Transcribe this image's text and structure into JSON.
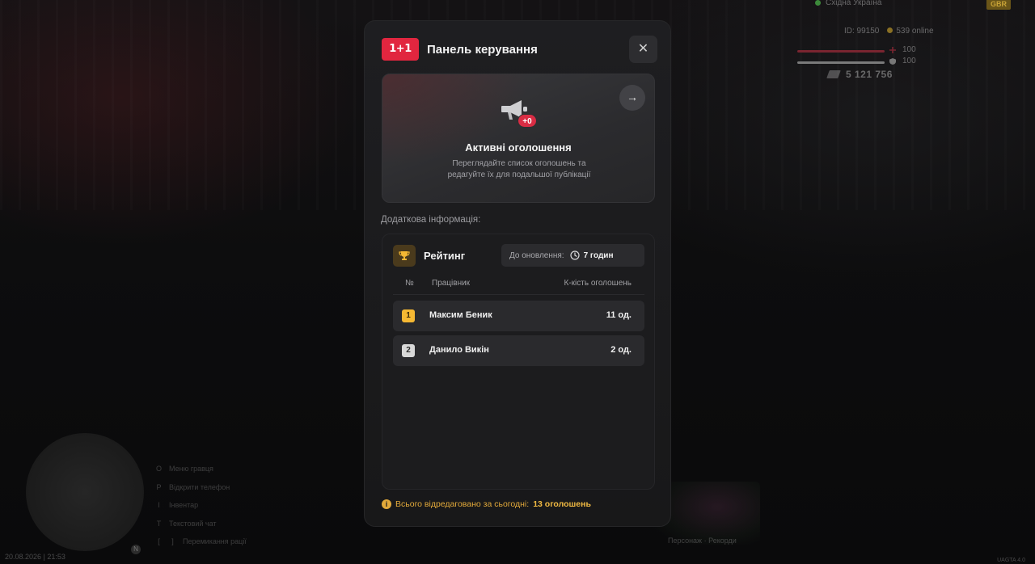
{
  "modal": {
    "title": "Панель керування",
    "logo_text": "1+1",
    "close_label": "✕",
    "ads_card": {
      "badge": "+0",
      "title": "Активні оголошення",
      "description": "Переглядайте список оголошень та редагуйте їх для подальшої публікації",
      "arrow_label": "→"
    },
    "extra_label": "Додаткова інформація:",
    "rating": {
      "title": "Рейтинг",
      "update_label": "До оновлення:",
      "update_value": "7 годин",
      "columns": {
        "num": "№",
        "name": "Працівник",
        "count": "К-кість оголошень"
      },
      "rows": [
        {
          "rank": "1",
          "name": "Максим Беник",
          "count": "11 од."
        },
        {
          "rank": "2",
          "name": "Данило Викін",
          "count": "2 од."
        }
      ]
    },
    "footer": {
      "label": "Всього відредаговано за сьогодні:",
      "value": "13 оголошень"
    }
  },
  "colors": {
    "brand": "#e1263f",
    "badge": "#d92c44",
    "gold": "#f5b833",
    "accent_text": "#e2a93a"
  },
  "hud": {
    "region": "Східна Україна",
    "logo": "GBR",
    "player_id": "ID: 99150",
    "online": "539 online",
    "health": "100",
    "armor": "100",
    "money": "5 121 756",
    "hints": [
      {
        "key": "O",
        "label": "Меню гравця"
      },
      {
        "key": "P",
        "label": "Відкрити телефон"
      },
      {
        "key": "I",
        "label": "Інвентар"
      },
      {
        "key": "T",
        "label": "Текстовий чат"
      },
      {
        "key": "[",
        "key2": "]",
        "label": "Перемикання рації"
      }
    ],
    "datetime": "20.08.2026 | 21:53",
    "version": "UAGTA 4.0",
    "promo_label": "Персонаж · Рекорди",
    "map_marker": "N"
  }
}
